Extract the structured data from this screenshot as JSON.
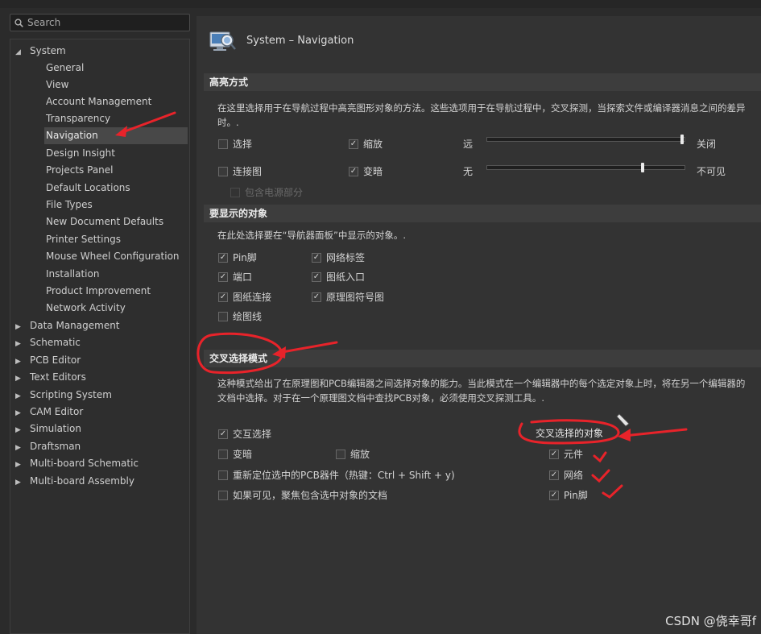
{
  "search": {
    "placeholder": "Search"
  },
  "tree": {
    "system": "System",
    "children": [
      "General",
      "View",
      "Account Management",
      "Transparency",
      "Navigation",
      "Design Insight",
      "Projects Panel",
      "Default Locations",
      "File Types",
      "New Document Defaults",
      "Printer Settings",
      "Mouse Wheel Configuration",
      "Installation",
      "Product Improvement",
      "Network Activity"
    ],
    "selected": "Navigation",
    "top_items": [
      "Data Management",
      "Schematic",
      "PCB Editor",
      "Text Editors",
      "Scripting System",
      "CAM Editor",
      "Simulation",
      "Draftsman",
      "Multi-board Schematic",
      "Multi-board Assembly"
    ]
  },
  "header": {
    "title": "System – Navigation"
  },
  "highlight": {
    "title": "高亮方式",
    "desc": "在这里选择用于在导航过程中高亮图形对象的方法。这些选项用于在导航过程中，交叉探测，当探索文件或编译器消息之间的差异时。.",
    "opt_select": "选择",
    "opt_select_checked": false,
    "opt_zoom": "缩放",
    "opt_zoom_checked": true,
    "far_label": "远",
    "close_label": "关闭",
    "zoom_level": 1.0,
    "opt_connect": "连接图",
    "opt_connect_checked": false,
    "opt_dim": "变暗",
    "opt_dim_checked": true,
    "none_label": "无",
    "invisible_label": "不可见",
    "dim_level": 0.79,
    "opt_power": "包含电源部分"
  },
  "display": {
    "title": "要显示的对象",
    "desc": "在此处选择要在“导航器面板”中显示的对象。.",
    "items": [
      {
        "label": "Pin脚",
        "checked": true
      },
      {
        "label": "网络标签",
        "checked": true
      },
      {
        "label": "端口",
        "checked": true
      },
      {
        "label": "图纸入口",
        "checked": true
      },
      {
        "label": "图纸连接",
        "checked": true
      },
      {
        "label": "原理图符号图",
        "checked": true
      },
      {
        "label": "绘图线",
        "checked": false
      }
    ]
  },
  "cross": {
    "title": "交叉选择模式",
    "desc": "这种模式给出了在原理图和PCB编辑器之间选择对象的能力。当此模式在一个编辑器中的每个选定对象上时，将在另一个编辑器的文档中选择。对于在一个原理图文档中查找PCB对象，必须使用交叉探测工具。.",
    "interactive": "交互选择",
    "interactive_checked": true,
    "dim": "变暗",
    "zoom": "缩放",
    "relocate": "重新定位选中的PCB器件（热键：Ctrl + Shift + y)",
    "focus": "如果可见，聚焦包含选中对象的文档",
    "objects_title": "交叉选择的对象",
    "objects": [
      {
        "label": "元件",
        "checked": true
      },
      {
        "label": "网络",
        "checked": true
      },
      {
        "label": "Pin脚",
        "checked": true
      }
    ]
  },
  "watermark": "CSDN @侥幸哥f",
  "colors": {
    "annotation": "#e8232a",
    "background": "#2b2b2b",
    "panel": "#333333"
  }
}
